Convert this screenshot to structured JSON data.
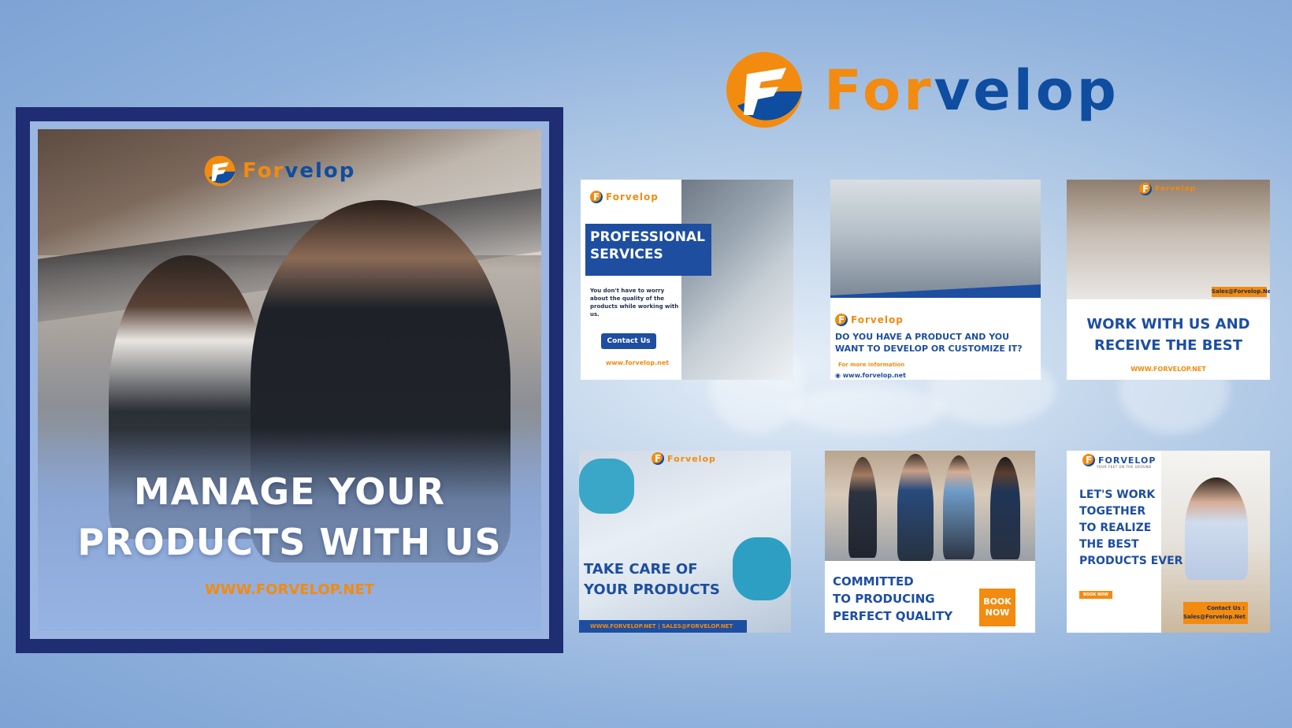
{
  "brand": {
    "name_part1": "For",
    "name_part2": "velop",
    "colors": {
      "orange": "#f28b10",
      "blue": "#0e4da0",
      "navy": "#1f2d73"
    }
  },
  "hero": {
    "logo_part1": "For",
    "logo_part2": "velop",
    "title_line1": "MANAGE YOUR",
    "title_line2": "PRODUCTS WITH US",
    "url": "WWW.FORVELOP.NET"
  },
  "cards": [
    {
      "logo": "Forvelop",
      "title_line1": "PROFESSIONAL",
      "title_line2": "SERVICES",
      "description": "You don't have to worry about the quality of the products while working with us.",
      "button": "Contact Us",
      "url": "www.forvelop.net"
    },
    {
      "logo": "Forvelop",
      "title_line1": "DO YOU HAVE A PRODUCT AND YOU",
      "title_line2": "WANT TO DEVELOP OR CUSTOMIZE IT?",
      "info": "For more information",
      "url": "www.forvelop.net"
    },
    {
      "logo": "Forvelop",
      "email_tag": "Sales@Forvelop.Net",
      "title_line1": "WORK WITH US AND",
      "title_line2": "RECEIVE THE BEST",
      "url": "WWW.FORVELOP.NET"
    },
    {
      "logo": "Forvelop",
      "title_line1": "TAKE CARE OF",
      "title_line2": "YOUR PRODUCTS",
      "footer": "WWW.FORVELOP.NET | SALES@FORVELOP.NET"
    },
    {
      "title_line1": "COMMITTED",
      "title_line2": "TO PRODUCING",
      "title_line3": "PERFECT QUALITY",
      "button_line1": "BOOK",
      "button_line2": "NOW"
    },
    {
      "logo": "FORVELOP",
      "tagline": "YOUR FEET ON THE GROUND",
      "title_line1": "LET'S WORK",
      "title_line2": "TOGETHER",
      "title_line3": "TO REALIZE",
      "title_line4": "THE BEST",
      "title_line5": "PRODUCTS EVER",
      "button": "BOOK NOW",
      "contact_label": "Contact Us :",
      "contact_email": "Sales@Forvelop.Net"
    }
  ]
}
